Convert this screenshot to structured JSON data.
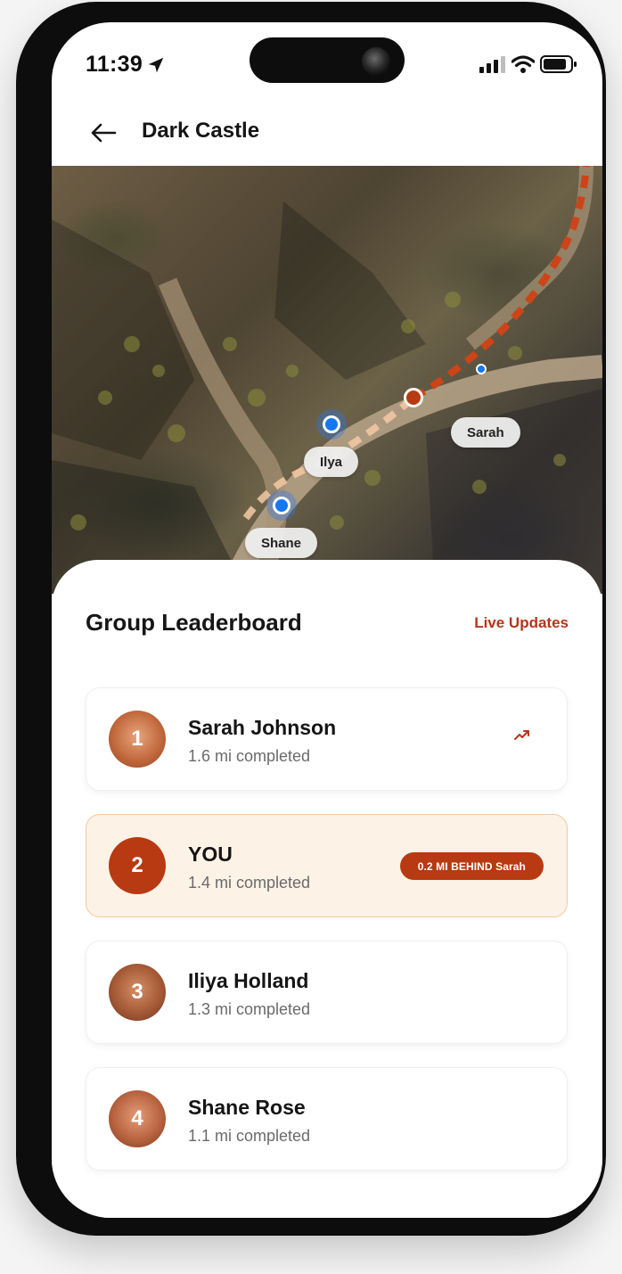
{
  "status_bar": {
    "time": "11:39"
  },
  "header": {
    "title": "Dark Castle"
  },
  "map": {
    "labels": {
      "ilya": "Ilya",
      "sarah": "Sarah",
      "shane": "Shane"
    }
  },
  "leaderboard": {
    "title": "Group Leaderboard",
    "live_updates": "Live Updates",
    "entries": [
      {
        "rank": "1",
        "name": "Sarah Johnson",
        "distance": "1.6 mi completed"
      },
      {
        "rank": "2",
        "name": "YOU",
        "distance": "1.4 mi completed",
        "badge": "0.2 MI BEHIND Sarah"
      },
      {
        "rank": "3",
        "name": "Iliya Holland",
        "distance": "1.3 mi completed"
      },
      {
        "rank": "4",
        "name": "Shane Rose",
        "distance": "1.1 mi completed"
      }
    ]
  },
  "colors": {
    "accent": "#b83a12",
    "highlight_bg": "#fdf2e6",
    "pin_blue": "#1677f3"
  }
}
